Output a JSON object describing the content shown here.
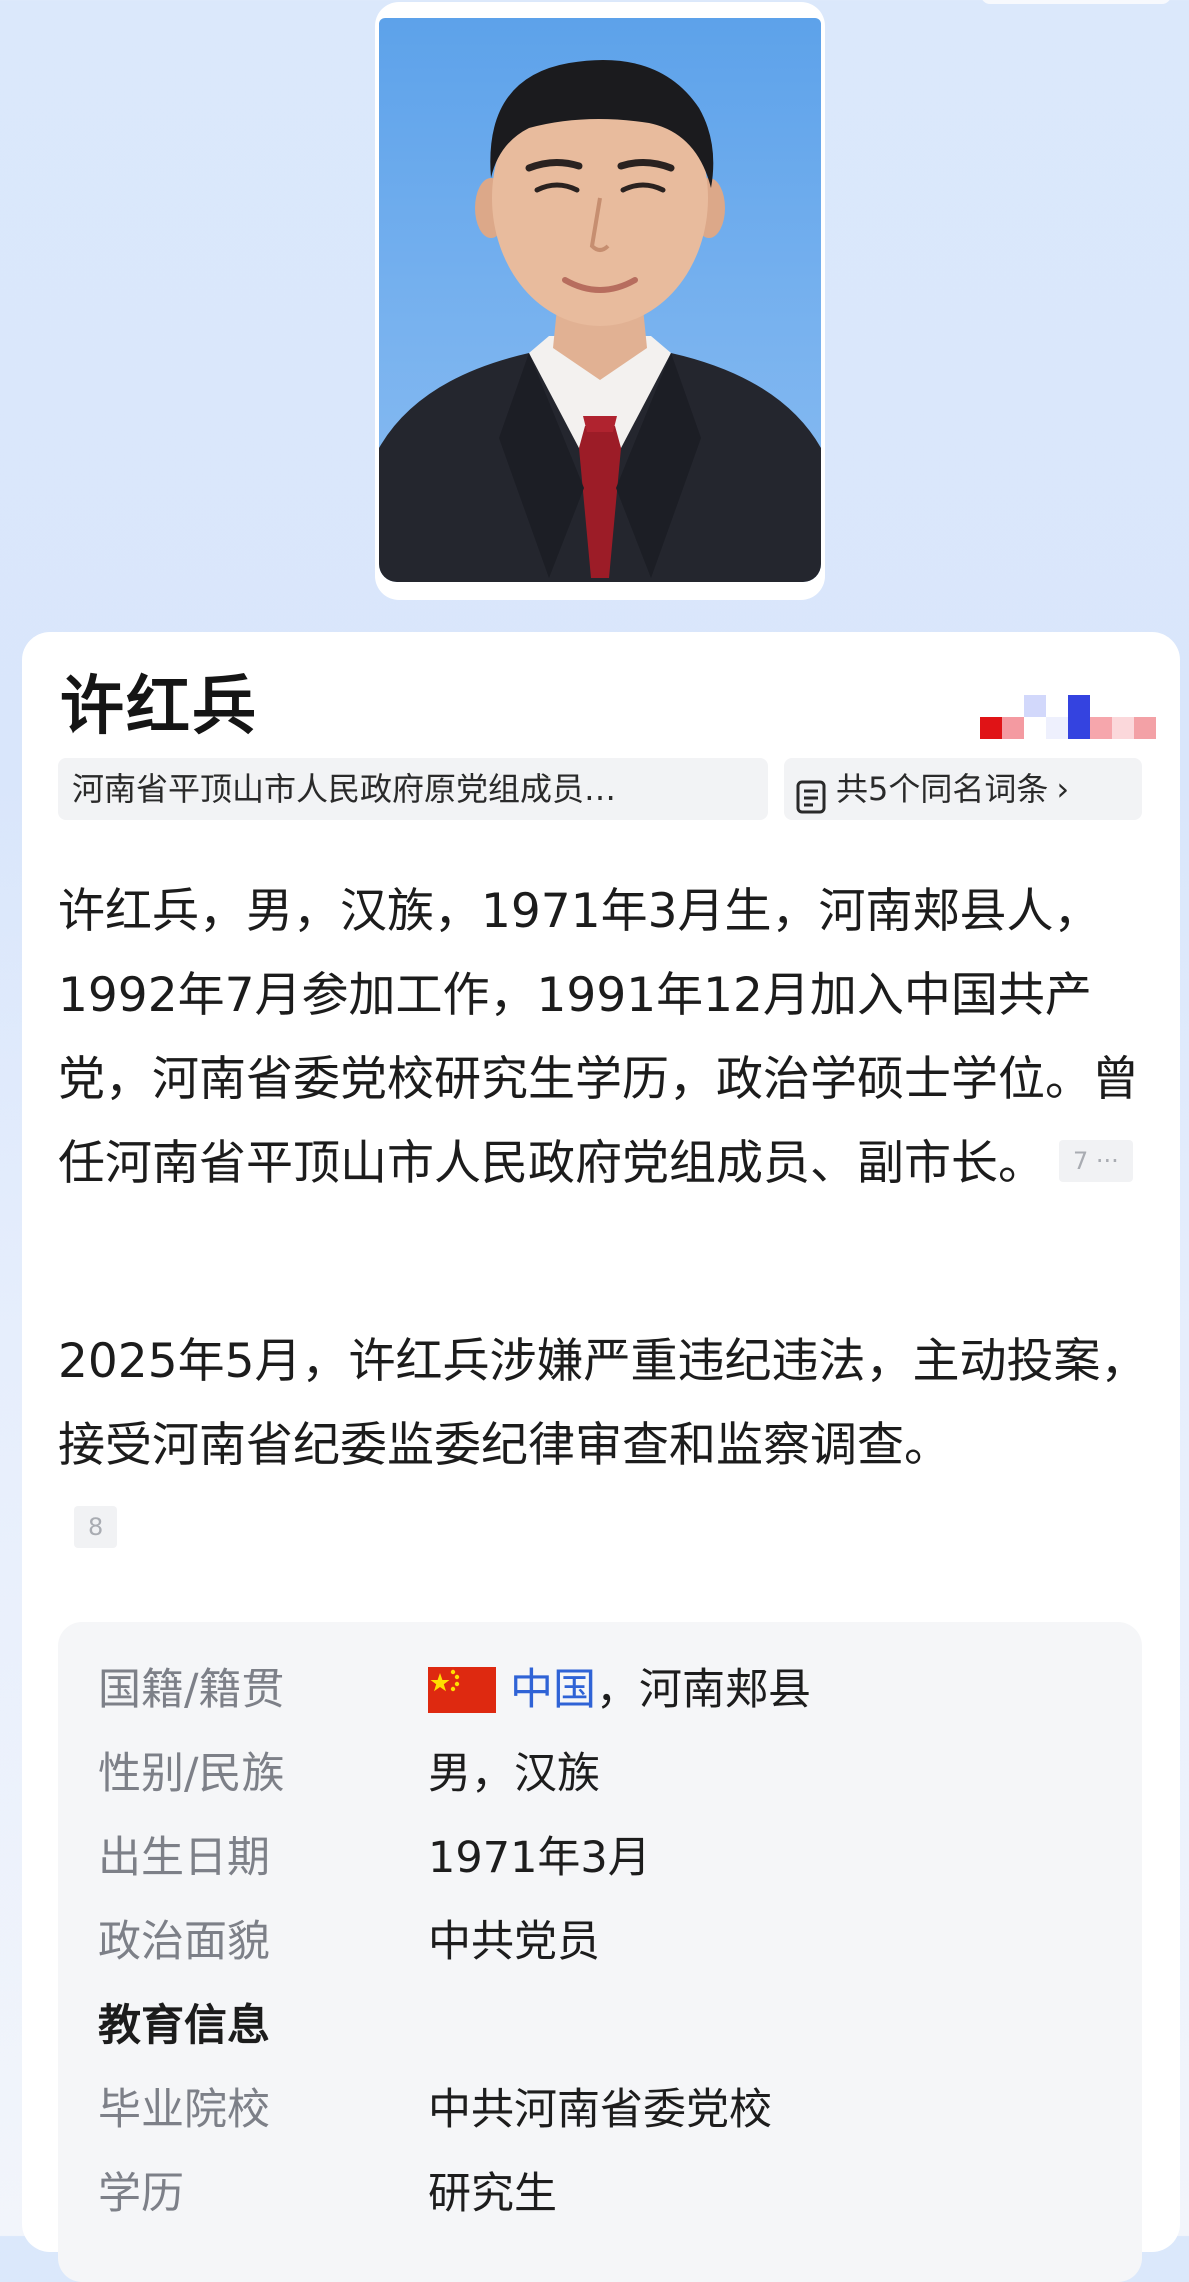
{
  "person": {
    "name": "许红兵",
    "chip_title": "河南省平顶山市人民政府原党组成员…",
    "more_entries": "共5个同名词条",
    "photo_alt": "许红兵"
  },
  "summary": {
    "paragraph1": "许红兵，男，汉族，1971年3月生，河南郏县人，1992年7月参加工作，1991年12月加入中国共产党，河南省委党校研究生学历，政治学硕士学位。曾任河南省平顶山市人民政府党组成员、副市长。",
    "paragraph1_cite": "7 ···",
    "paragraph2": "2025年5月，许红兵涉嫌严重违纪违法，主动投案，接受河南省纪委监委纪律审查和监察调查。",
    "paragraph2_cite": "8"
  },
  "infobox": {
    "rows": [
      {
        "label": "国籍/籍贯",
        "value_link": "中国",
        "value_rest": "，河南郏县"
      },
      {
        "label": "性别/民族",
        "value": "男，汉族"
      },
      {
        "label": "出生日期",
        "value": "1971年3月"
      },
      {
        "label": "政治面貌",
        "value": "中共党员"
      }
    ],
    "section_education": "教育信息",
    "education_rows": [
      {
        "label": "毕业院校",
        "value": "中共河南省委党校"
      },
      {
        "label": "学历",
        "value": "研究生"
      }
    ]
  },
  "colors": {
    "link": "#2f63d6",
    "label_gray": "#7d8088",
    "flag_red": "#de2910",
    "flag_yellow": "#ffde00"
  },
  "icons": {
    "entries": "document-icon",
    "chevron": "chevron-right-icon",
    "flag": "china-flag-icon"
  }
}
